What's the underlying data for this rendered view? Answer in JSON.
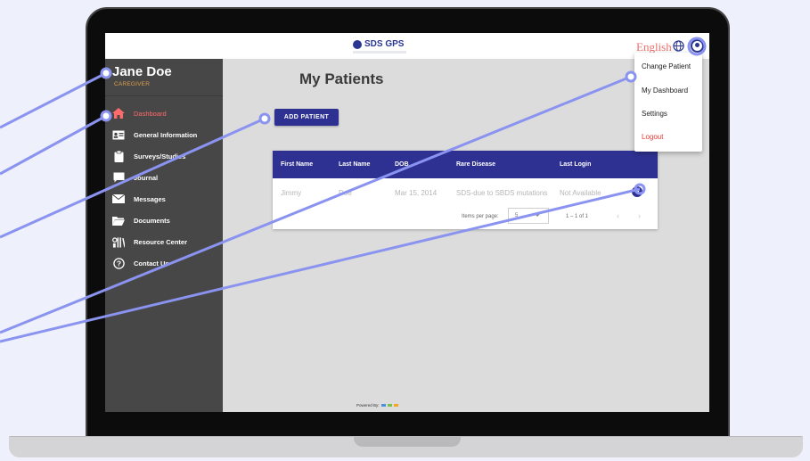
{
  "app": {
    "logo_text": "SDS GPS",
    "language": "English"
  },
  "user": {
    "name": "Jane Doe",
    "role": "CAREGIVER"
  },
  "sidebar": {
    "items": [
      {
        "label": "Dashboard",
        "icon": "home-icon",
        "active": true
      },
      {
        "label": "General Information",
        "icon": "id-card-icon"
      },
      {
        "label": "Surveys/Studies",
        "icon": "clipboard-icon"
      },
      {
        "label": "Journal",
        "icon": "journal-icon"
      },
      {
        "label": "Messages",
        "icon": "envelope-icon"
      },
      {
        "label": "Documents",
        "icon": "folder-icon"
      },
      {
        "label": "Resource Center",
        "icon": "library-icon"
      },
      {
        "label": "Contact Us",
        "icon": "question-icon"
      }
    ]
  },
  "main": {
    "title": "My Patients",
    "add_button": "ADD PATIENT"
  },
  "table": {
    "columns": [
      "First Name",
      "Last Name",
      "DOB",
      "Rare Disease",
      "Last Login"
    ],
    "rows": [
      {
        "first": "Jimmy",
        "last": "Doe",
        "dob": "Mar 15, 2014",
        "disease": "SDS-due to SBDS mutations",
        "last_login": "Not Available"
      }
    ],
    "items_per_page_label": "Items per page:",
    "items_per_page": "5",
    "range": "1 – 1 of 1"
  },
  "footer": {
    "powered_by": "Powered By:"
  },
  "user_menu": {
    "items": [
      "Change Patient",
      "My Dashboard",
      "Settings",
      "Logout"
    ]
  },
  "colors": {
    "primary": "#2e3192",
    "sidebar": "#474747",
    "active_nav": "#ff6b6b",
    "role": "#e0a24a",
    "callout": "#8a93f0",
    "logout": "#e53935"
  }
}
